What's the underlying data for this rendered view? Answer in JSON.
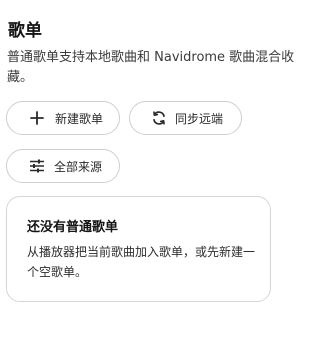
{
  "page": {
    "title": "歌单",
    "subtitle": "普通歌单支持本地歌曲和 Navidrome 歌曲混合收藏。"
  },
  "actions": {
    "new_playlist": {
      "label": "新建歌单",
      "icon": "plus-icon"
    },
    "sync_remote": {
      "label": "同步远端",
      "icon": "sync-icon"
    },
    "all_sources": {
      "label": "全部来源",
      "icon": "filter-sliders-icon"
    }
  },
  "empty_state": {
    "title": "还没有普通歌单",
    "description": "从播放器把当前歌曲加入歌单，或先新建一个空歌单。"
  },
  "colors": {
    "background": "#ffffff",
    "text": "#1c1c1c",
    "border": "#cfcfcf"
  }
}
